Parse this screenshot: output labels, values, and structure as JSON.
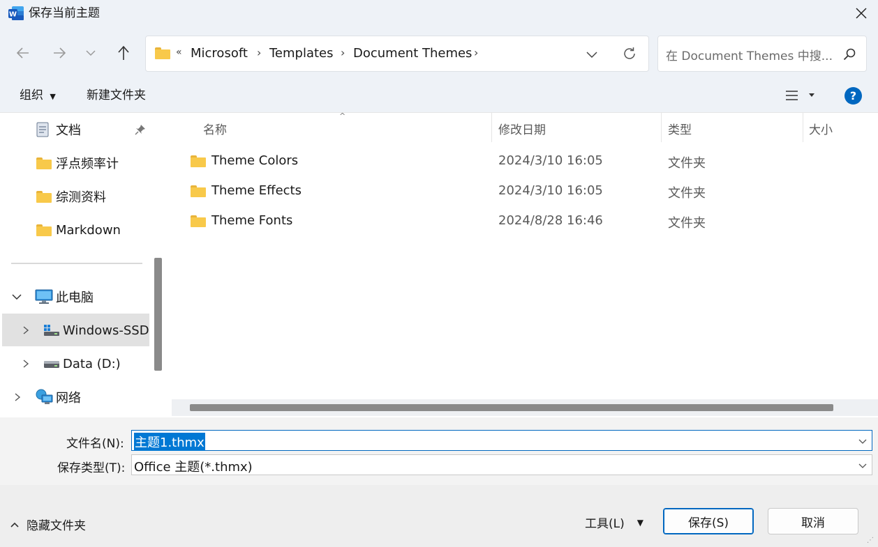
{
  "window": {
    "title": "保存当前主题",
    "app_icon": "word-icon"
  },
  "address": {
    "path": [
      "Microsoft",
      "Templates",
      "Document Themes"
    ],
    "overflow": "«"
  },
  "search": {
    "placeholder": "在 Document Themes 中搜..."
  },
  "toolbar": {
    "organize": "组织",
    "new_folder": "新建文件夹"
  },
  "sidebar": {
    "quick_access": [
      {
        "label": "文档",
        "icon": "document-icon",
        "pinned": true
      },
      {
        "label": "浮点频率计",
        "icon": "folder-icon"
      },
      {
        "label": "综测资料",
        "icon": "folder-icon"
      },
      {
        "label": "Markdown",
        "icon": "folder-icon"
      }
    ],
    "this_pc": "此电脑",
    "drives": [
      {
        "label": "Windows-SSD",
        "icon": "windows-drive-icon",
        "selected": true
      },
      {
        "label": "Data (D:)",
        "icon": "drive-icon"
      }
    ],
    "network": "网络"
  },
  "columns": {
    "name": "名称",
    "date": "修改日期",
    "type": "类型",
    "size": "大小"
  },
  "files": [
    {
      "name": "Theme Colors",
      "date": "2024/3/10 16:05",
      "type": "文件夹"
    },
    {
      "name": "Theme Effects",
      "date": "2024/3/10 16:05",
      "type": "文件夹"
    },
    {
      "name": "Theme Fonts",
      "date": "2024/8/28 16:46",
      "type": "文件夹"
    }
  ],
  "filename": {
    "label": "文件名(N):",
    "value": "主题1.thmx"
  },
  "filetype": {
    "label": "保存类型(T):",
    "value": "Office 主题(*.thmx)"
  },
  "footer": {
    "hide_folders": "隐藏文件夹",
    "tools": "工具(L)",
    "save": "保存(S)",
    "cancel": "取消"
  },
  "colors": {
    "accent": "#0067c0",
    "selection": "#0078d4",
    "chrome": "#eef2f7"
  }
}
